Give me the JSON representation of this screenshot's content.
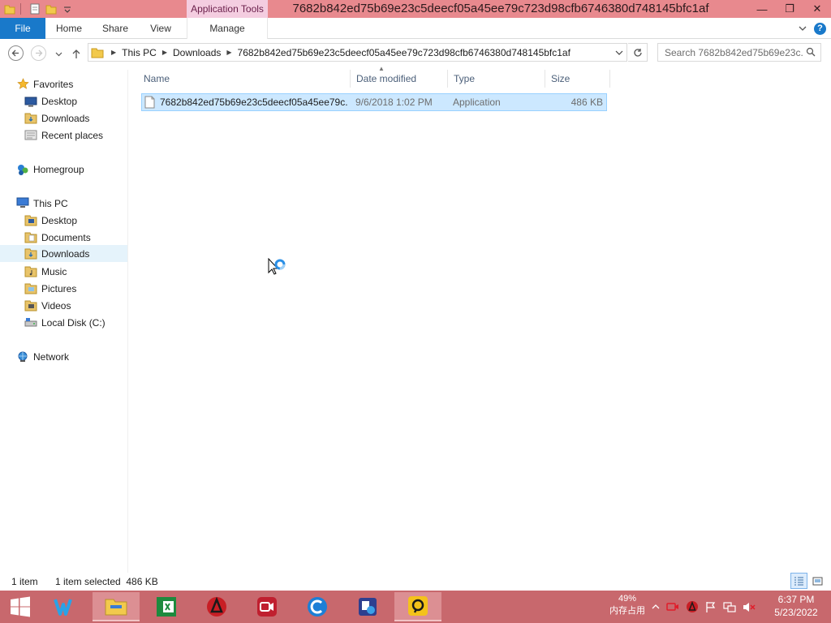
{
  "window": {
    "title": "7682b842ed75b69e23c5deecf05a45ee79c723d98cfb6746380d748145bfc1af",
    "context_tab": "Application Tools",
    "minimize": "—",
    "restore": "❐",
    "close": "✕"
  },
  "ribbon": {
    "file": "File",
    "home": "Home",
    "share": "Share",
    "view": "View",
    "manage": "Manage"
  },
  "address": {
    "crumbs": [
      "This PC",
      "Downloads",
      "7682b842ed75b69e23c5deecf05a45ee79c723d98cfb6746380d748145bfc1af"
    ]
  },
  "search": {
    "placeholder": "Search 7682b842ed75b69e23c..."
  },
  "nav": {
    "favorites": "Favorites",
    "fav_desktop": "Desktop",
    "fav_downloads": "Downloads",
    "fav_recent": "Recent places",
    "homegroup": "Homegroup",
    "this_pc": "This PC",
    "pc_desktop": "Desktop",
    "pc_documents": "Documents",
    "pc_downloads": "Downloads",
    "pc_music": "Music",
    "pc_pictures": "Pictures",
    "pc_videos": "Videos",
    "pc_local_disk": "Local Disk (C:)",
    "network": "Network"
  },
  "columns": {
    "name": "Name",
    "date": "Date modified",
    "type": "Type",
    "size": "Size"
  },
  "files": [
    {
      "name": "7682b842ed75b69e23c5deecf05a45ee79c...",
      "date": "9/6/2018 1:02 PM",
      "type": "Application",
      "size": "486 KB"
    }
  ],
  "status": {
    "count": "1 item",
    "selected": "1 item selected  486 KB"
  },
  "taskbar": {
    "mem_percent": "49%",
    "mem_label": "内存占用",
    "time": "6:37 PM",
    "date": "5/23/2022"
  },
  "colors": {
    "titlebar": "#e8898e",
    "taskbar": "#c8686d",
    "file_tab": "#1979ca",
    "selection": "#cce8ff",
    "context_tab": "#f4cde0"
  }
}
